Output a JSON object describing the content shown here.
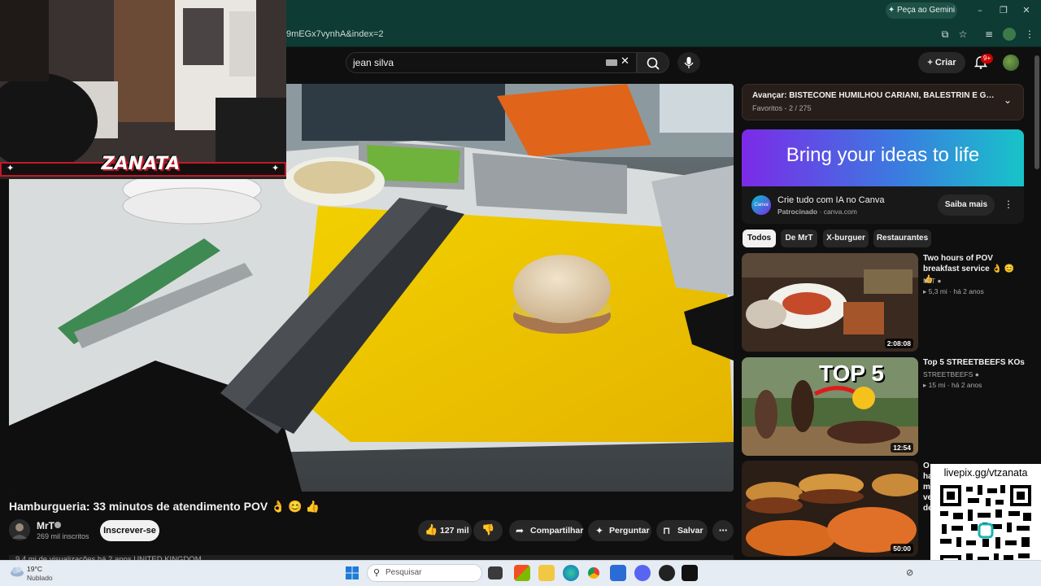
{
  "browser": {
    "url": "9mEGx7vynhA&index=2",
    "gemini_label": "Peça ao Gemini",
    "window_controls": [
      "–",
      "❐",
      "✕"
    ]
  },
  "header": {
    "search_value": "jean silva",
    "create_label": "Criar",
    "notifications_badge": "9+"
  },
  "webcam": {
    "streamer_logo": "ZANATA"
  },
  "video": {
    "title": "Hamburgueria: 33 minutos de atendimento POV 👌 😊 👍",
    "channel": "MrT",
    "subscribers": "269 mil inscritos",
    "subscribe_label": "Inscrever-se",
    "likes": "127 mil",
    "share_label": "Compartilhar",
    "ask_label": "Perguntar",
    "save_label": "Salvar",
    "description_line": "9,4 mi de visualizações  há 2 anos  UNITED KINGDOM"
  },
  "playlist": {
    "next_label": "Avançar: BISTECONE HUMILHOU CARIANI, BALESTRIN E GABRIEL NO...",
    "meta": "Favoritos - 2 / 275"
  },
  "ad": {
    "banner_text": "Bring your ideas to life",
    "logo_text": "Canva",
    "title": "Crie tudo com IA no Canva",
    "sponsor_label": "Patrocinado",
    "sponsor_domain": "canva.com",
    "cta_label": "Saiba mais"
  },
  "chips": [
    "Todos",
    "De MrT",
    "X-burguer",
    "Restaurantes"
  ],
  "recommendations": [
    {
      "title": "Two hours of POV breakfast service 👌 😊 👍",
      "channel": "MrT",
      "views": "5,3 mi",
      "age": "há 2 anos",
      "duration": "2:08:08"
    },
    {
      "title": "Top 5 STREETBEEFS KOs",
      "channel": "STREETBEEFS",
      "views": "15 mi",
      "age": "há 2 anos",
      "duration": "12:54",
      "thumb_text": "TOP 5"
    },
    {
      "title": "O hambúrguer mais vendido de",
      "channel": "",
      "views": "",
      "age": "",
      "duration": "50:00"
    }
  ],
  "qr_overlay": {
    "label": "livepix.gg/vtzanata"
  },
  "taskbar": {
    "temperature": "19°C",
    "weather": "Nublado",
    "search_placeholder": "Pesquisar"
  }
}
